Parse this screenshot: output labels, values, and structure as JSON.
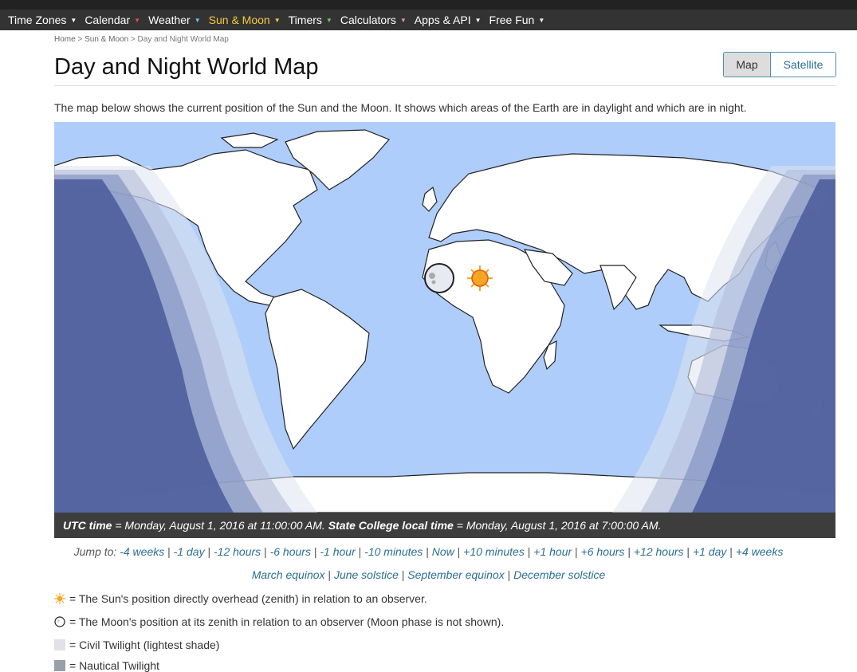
{
  "nav": {
    "items": [
      {
        "label": "Time Zones"
      },
      {
        "label": "Calendar"
      },
      {
        "label": "Weather"
      },
      {
        "label": "Sun & Moon"
      },
      {
        "label": "Timers"
      },
      {
        "label": "Calculators"
      },
      {
        "label": "Apps & API"
      },
      {
        "label": "Free Fun"
      }
    ]
  },
  "breadcrumb": {
    "home": "Home",
    "sep1": " > ",
    "section": "Sun & Moon",
    "sep2": " > ",
    "current": "Day and Night World Map"
  },
  "page_title": "Day and Night World Map",
  "view_toggle": {
    "map": "Map",
    "satellite": "Satellite"
  },
  "intro": "The map below shows the current position of the Sun and the Moon. It shows which areas of the Earth are in daylight and which are in night.",
  "colors": {
    "ocean": "#aecdfb",
    "night": "#4a5a9a",
    "land": "#ffffff",
    "sun": "#f6a623",
    "timebar": "#3d3d3d",
    "link": "#2a6e93"
  },
  "timebar": {
    "utc_label": "UTC time",
    "utc_value": " = Monday, August 1, 2016 at 11:00:00 AM. ",
    "local_label": "State College local time",
    "local_value": " = Monday, August 1, 2016 at 7:00:00 AM."
  },
  "jump": {
    "prefix": "Jump to: ",
    "links": [
      "-4 weeks",
      "-1 day",
      "-12 hours",
      "-6 hours",
      "-1 hour",
      "-10 minutes",
      "Now",
      "+10 minutes",
      "+1 hour",
      "+6 hours",
      "+12 hours",
      "+1 day",
      "+4 weeks"
    ],
    "seasons": [
      "March equinox",
      "June solstice",
      "September equinox",
      "December solstice"
    ]
  },
  "legend": {
    "sun": " = The Sun's position directly overhead (zenith) in relation to an observer.",
    "moon": " = The Moon's position at its zenith in relation to an observer (Moon phase is not shown).",
    "civil": " = Civil Twilight (lightest shade)",
    "nautical": " = Nautical Twilight"
  }
}
